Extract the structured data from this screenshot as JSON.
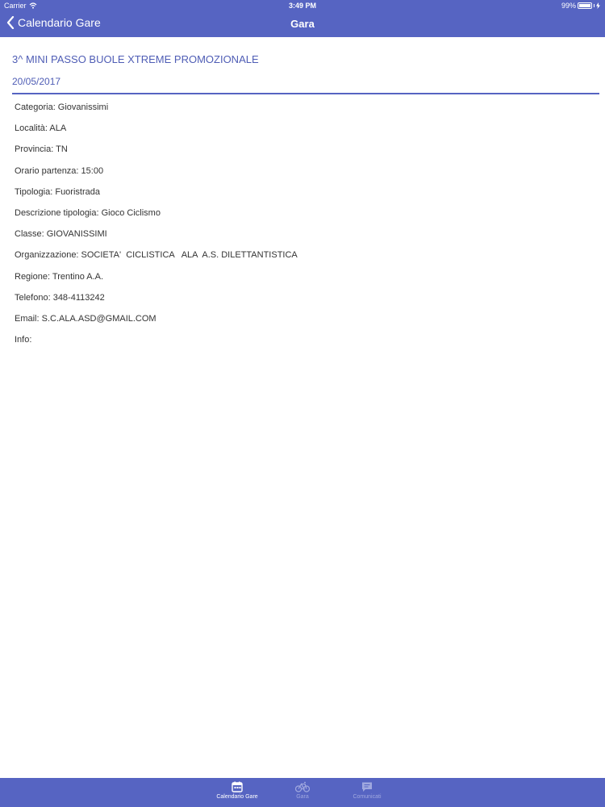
{
  "status": {
    "carrier": "Carrier",
    "time": "3:49 PM",
    "battery": "99%"
  },
  "nav": {
    "back_label": "Calendario Gare",
    "title": "Gara"
  },
  "race": {
    "title": "3^ MINI PASSO BUOLE XTREME PROMOZIONALE",
    "date": "20/05/2017"
  },
  "details": [
    "Categoria: Giovanissimi",
    "Località: ALA",
    "Provincia: TN",
    "Orario partenza: 15:00",
    "Tipologia: Fuoristrada",
    "Descrizione tipologia: Gioco Ciclismo",
    "Classe: GIOVANISSIMI",
    "Organizzazione: SOCIETA'  CICLISTICA   ALA  A.S. DILETTANTISTICA",
    "Regione: Trentino A.A.",
    "Telefono: 348-4113242",
    "Email: S.C.ALA.ASD@GMAIL.COM",
    "Info:"
  ],
  "tabs": [
    {
      "label": "Calendario Gare",
      "icon": "calendar-icon",
      "active": true
    },
    {
      "label": "Gara",
      "icon": "bicycle-icon",
      "active": false
    },
    {
      "label": "Comunicati",
      "icon": "chat-bubble-icon",
      "active": false
    }
  ],
  "colors": {
    "primary": "#5664c2",
    "title_text": "#4f5db5",
    "body_text": "#333333",
    "inactive_tab": "#a0a8df"
  }
}
